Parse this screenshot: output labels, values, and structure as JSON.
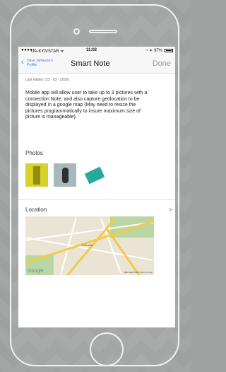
{
  "status_bar": {
    "signal": "●●●●○",
    "carrier": "UA-KYIVSTAR ᯤ",
    "time": "11:02",
    "battery": "◔ ∗ 97%"
  },
  "nav": {
    "back_label": "Dave Jameson's Profile",
    "title": "Smart Note",
    "done_label": "Done"
  },
  "note": {
    "last_edited": "Last edited: (23 - 03 - 2016)",
    "description": "Mobile app will allow user to take up to 3 pictures with a connection Note, and also capture geolocation to be displayed in a google map (May need to resize the pictures programmatically to insure maximum size of picture is manageable)."
  },
  "photos": {
    "label": "Photos"
  },
  "location": {
    "label": "Location",
    "chevron": ">",
    "map_place_label": "Palo Alto",
    "map_logo": "Google",
    "map_attribution": "Map data ©2016 Terms of Use"
  },
  "colors": {
    "accent": "#3b78e7",
    "done_disabled": "#9a9a9a"
  }
}
